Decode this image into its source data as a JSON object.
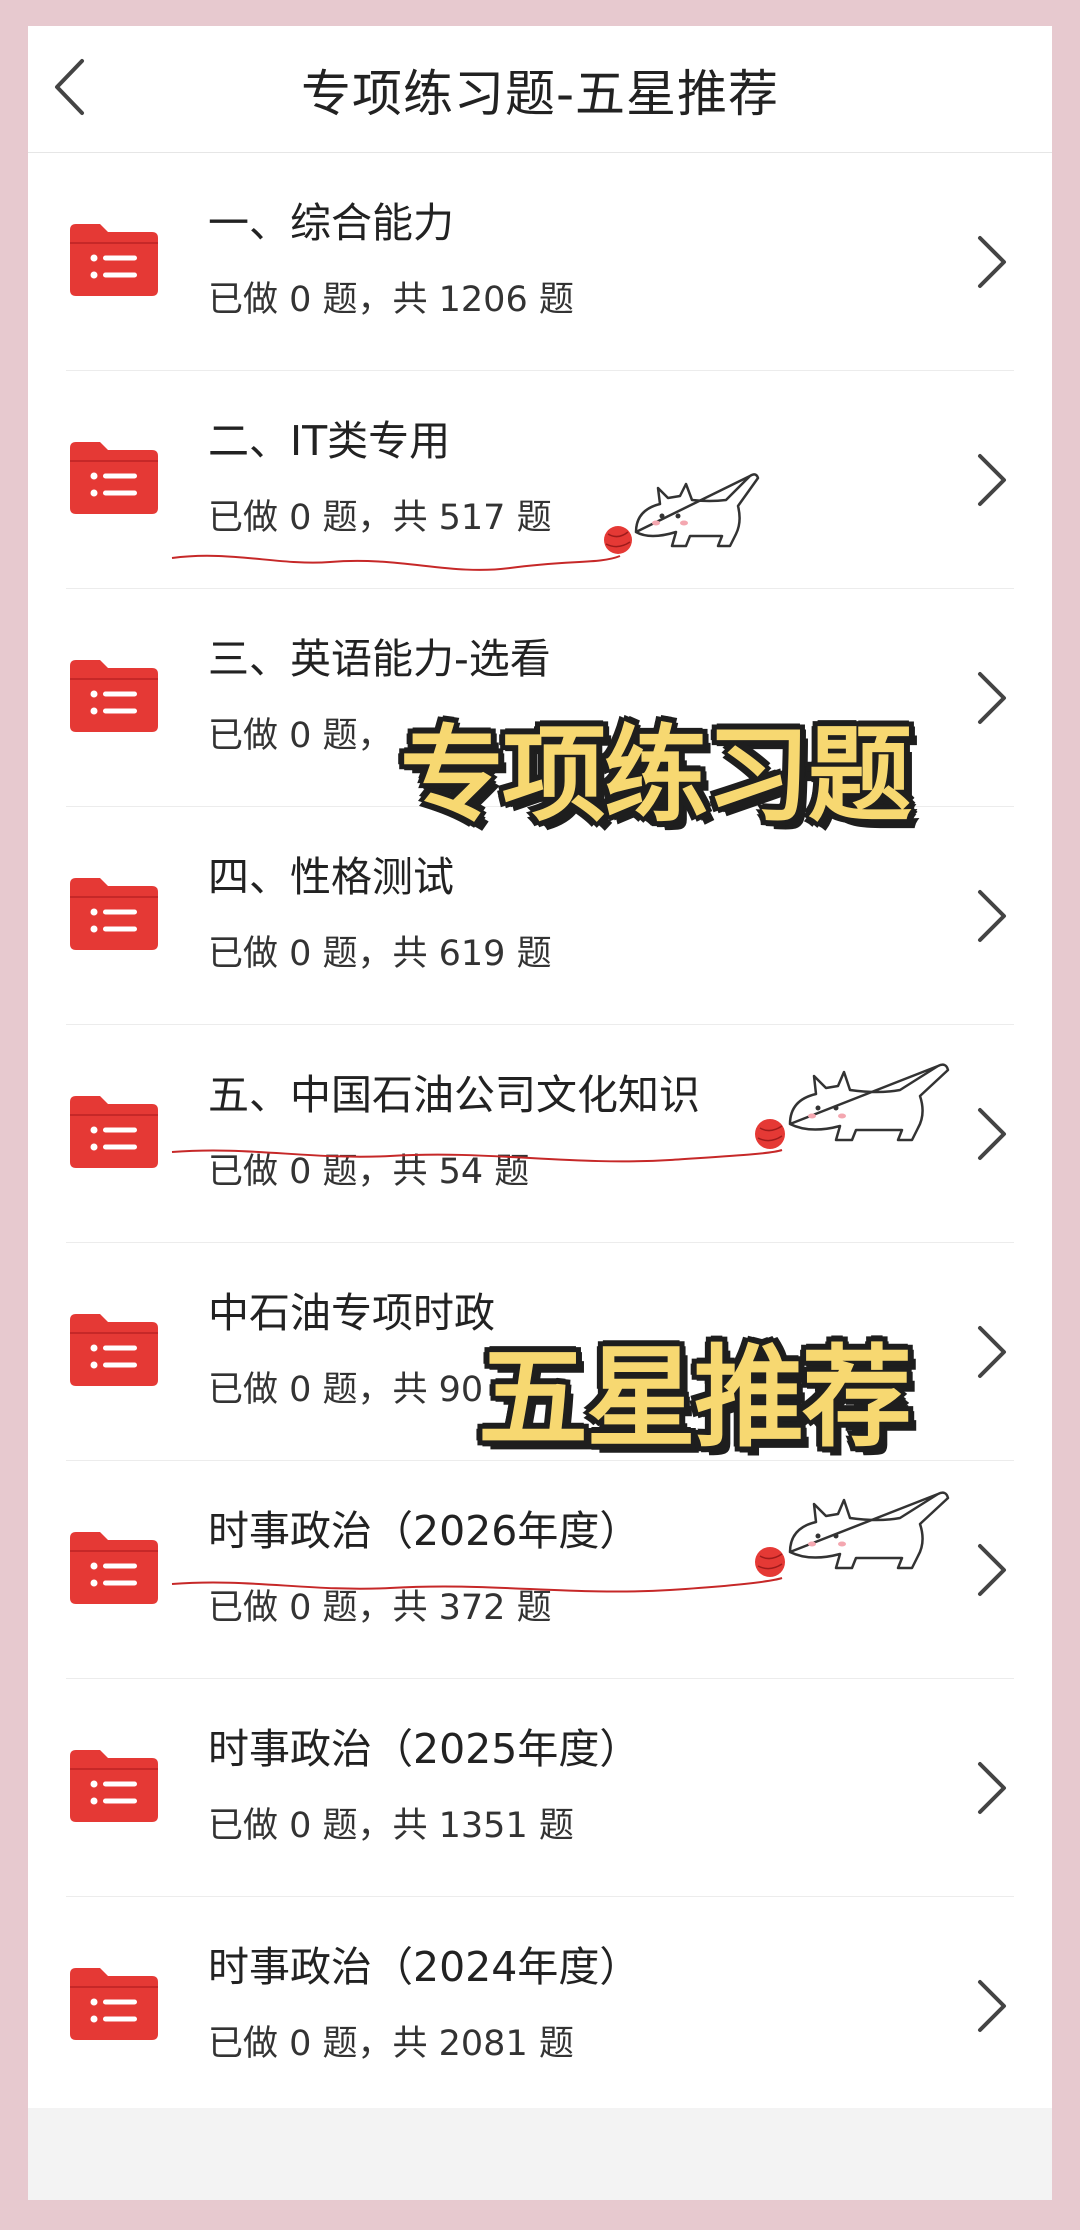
{
  "header": {
    "title": "专项练习题-五星推荐"
  },
  "items": [
    {
      "title": "一、综合能力",
      "sub": "已做 0 题，共 1206 题"
    },
    {
      "title": "二、IT类专用",
      "sub": "已做 0 题，共 517 题"
    },
    {
      "title": "三、英语能力-选看",
      "sub": "已做 0 题，"
    },
    {
      "title": "四、性格测试",
      "sub": "已做 0 题，共 619 题"
    },
    {
      "title": "五、中国石油公司文化知识",
      "sub": "已做 0 题，共 54 题"
    },
    {
      "title": "中石油专项时政",
      "sub": "已做 0 题，共 90"
    },
    {
      "title": "时事政治（2026年度）",
      "sub": "已做 0 题，共 372 题"
    },
    {
      "title": "时事政治（2025年度）",
      "sub": "已做 0 题，共 1351 题"
    },
    {
      "title": "时事政治（2024年度）",
      "sub": "已做 0 题，共 2081 题"
    }
  ],
  "overlays": {
    "text1": "专项练习题",
    "text2": "五星推荐"
  },
  "colors": {
    "folder": "#e53935",
    "overlay_fill": "#f7d871",
    "frame": "#e7c9cf"
  }
}
